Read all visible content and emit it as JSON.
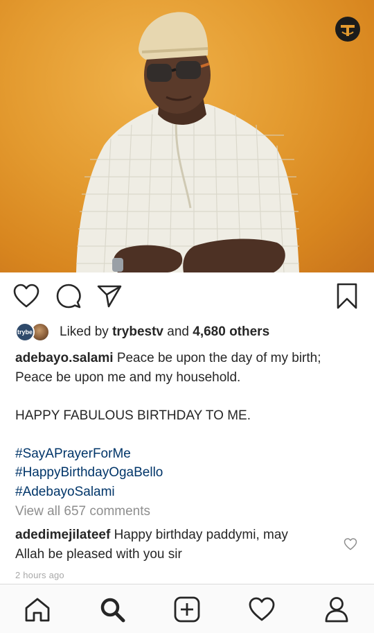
{
  "post": {
    "image_alt": "Man in cream patterned agbada and fila cap against orange backdrop",
    "watermark_icon": "trybe-logo-icon"
  },
  "actions": {
    "like_icon": "heart-outline-icon",
    "comment_icon": "comment-bubble-icon",
    "share_icon": "paper-plane-icon",
    "save_icon": "bookmark-icon"
  },
  "likes": {
    "prefix": "Liked by",
    "user": "trybestv",
    "middle": "and",
    "others": "4,680 others",
    "avatar1_text": "trybe"
  },
  "caption": {
    "username": "adebayo.salami",
    "line1": "Peace be upon the day of my birth; Peace be upon me and my household.",
    "line2": "HAPPY FABULOUS BIRTHDAY TO ME.",
    "hashtags": [
      "#SayAPrayerForMe",
      "#HappyBirthdayOgaBello",
      "#AdebayoSalami"
    ]
  },
  "comments": {
    "view_all": "View all 657 comments",
    "items": [
      {
        "username": "adedimejilateef",
        "text": "Happy birthday paddymi, may Allah be pleased with you sir"
      }
    ]
  },
  "timestamp": "2 hours ago",
  "tabbar": {
    "items": [
      "home-icon",
      "search-icon",
      "new-post-icon",
      "activity-heart-icon",
      "profile-icon"
    ],
    "active": "search-icon"
  }
}
